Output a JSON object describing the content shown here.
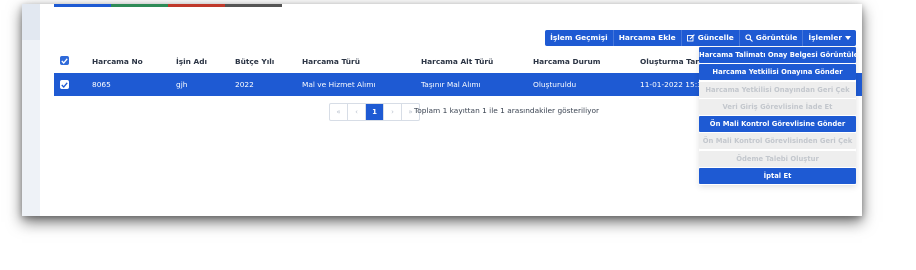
{
  "tabbar_colors": [
    "#1e5ad3",
    "#2e8b57",
    "#c0392b",
    "#555555"
  ],
  "toolbar": {
    "buttons": [
      {
        "label": "İşlem Geçmişi",
        "icon": ""
      },
      {
        "label": "Harcama Ekle",
        "icon": ""
      },
      {
        "label": "Güncelle",
        "icon": "edit-icon"
      },
      {
        "label": "Görüntüle",
        "icon": "search-icon"
      },
      {
        "label": "İşlemler",
        "icon": "caret-down-icon"
      }
    ]
  },
  "table": {
    "columns": [
      "Harcama No",
      "İşin Adı",
      "Bütçe Yılı",
      "Harcama Türü",
      "Harcama Alt Türü",
      "Harcama Durum",
      "Oluşturma Tarihi"
    ],
    "rows": [
      {
        "selected": true,
        "cells": [
          "8065",
          "gjh",
          "2022",
          "Mal ve Hizmet Alımı",
          "Taşınır Mal Alımı",
          "Oluşturuldu",
          "11-01-2022 15:30:"
        ]
      }
    ]
  },
  "pagination": {
    "first": "«",
    "prev": "‹",
    "current": "1",
    "next": "›",
    "last": "»",
    "info": "Toplam 1 kayıttan 1 ile 1 arasındakiler gösteriliyor"
  },
  "dropdown": {
    "items": [
      {
        "label": "Harcama Talimatı Onay Belgesi Görüntüle",
        "enabled": true
      },
      {
        "label": "Harcama Yetkilisi Onayına Gönder",
        "enabled": true
      },
      {
        "label": "Harcama Yetkilisi Onayından Geri Çek",
        "enabled": false
      },
      {
        "label": "Veri Giriş Görevlisine İade Et",
        "enabled": false
      },
      {
        "label": "Ön Mali Kontrol Görevlisine Gönder",
        "enabled": true
      },
      {
        "label": "Ön Mali Kontrol Görevlisinden Geri Çek",
        "enabled": false
      },
      {
        "label": "Ödeme Talebi Oluştur",
        "enabled": false
      },
      {
        "label": "İptal Et",
        "enabled": true
      }
    ]
  },
  "colors": {
    "accent": "#1e5ad3",
    "disabled_bg": "#eeeeee",
    "disabled_text": "#c3c7cd"
  }
}
